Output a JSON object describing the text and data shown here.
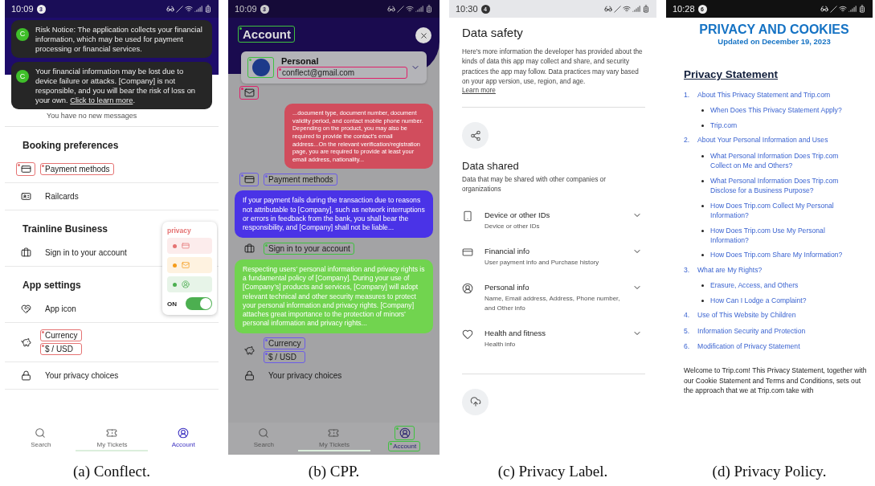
{
  "conflect": {
    "caption": "(a) Conflect.",
    "status": {
      "time": "10:09",
      "badge": "3"
    },
    "toasts": [
      {
        "avatar": "C",
        "text": "Risk Notice: The application collects your financial information, which may be used for payment processing or financial services."
      },
      {
        "avatar": "C",
        "text": "Your financial information may be lost due to device failure or attacks. [Company] is not responsible, and you will bear the risk of loss on your own. ",
        "link": "Click to learn more",
        "suffix": "."
      }
    ],
    "messages_note": "You have no new messages",
    "sections": [
      {
        "title": "Booking preferences",
        "rows": [
          {
            "kind": "card",
            "label": "Payment methods",
            "icon_highlight": {
              "color": "#e57373"
            },
            "label_highlight": {
              "color": "#e57373"
            }
          },
          {
            "kind": "railcard",
            "label": "Railcards"
          }
        ]
      },
      {
        "title": "Trainline Business",
        "rows": [
          {
            "kind": "briefcase",
            "label": "Sign in to your account"
          }
        ]
      },
      {
        "title": "App settings",
        "rows": [
          {
            "kind": "app",
            "label": "App icon"
          },
          {
            "kind": "piggy",
            "label": "Currency",
            "sub": "$ / USD",
            "label_highlight": {
              "color": "#e57373"
            },
            "sub_highlight": {
              "color": "#e57373"
            }
          },
          {
            "kind": "lock",
            "label": "Your privacy choices"
          }
        ]
      }
    ],
    "privacy_widget": {
      "title": "privacy",
      "items": [
        {
          "kind": "card",
          "color": "#e57373"
        },
        {
          "kind": "mail",
          "color": "#f59c1a"
        },
        {
          "kind": "user",
          "color": "#4caf50"
        }
      ],
      "toggle_label": "ON",
      "on": true
    },
    "nav": [
      {
        "kind": "search",
        "label": "Search",
        "selected": false
      },
      {
        "kind": "ticket",
        "label": "My Tickets",
        "selected": false
      },
      {
        "kind": "account",
        "label": "Account",
        "selected": true
      }
    ]
  },
  "cpp": {
    "caption": "(b) CPP.",
    "status": {
      "time": "10:09",
      "badge": "3"
    },
    "title": "Account",
    "title_highlight": {
      "color": "#3fc13f"
    },
    "profile": {
      "name": "Personal",
      "email": "conflect@gmail.com",
      "avatar_highlight": {
        "color": "#3fc13f"
      },
      "email_highlight": {
        "color": "#e0206a"
      }
    },
    "rows": [
      {
        "kind": "mail",
        "icon_highlight": {
          "color": "#e0206a"
        },
        "bubble": {
          "text": "...document type, document number, document validity period, and contact mobile phone number. Depending on the product, you may also be required to provide the contact’s email address...On the relevant verification/registration page, you are required to provide at least your email address, nationality...",
          "color": "#c8505e"
        }
      },
      {
        "kind": "card",
        "label": "Payment methods",
        "icon_highlight": {
          "color": "#6b5ce7"
        },
        "label_highlight": {
          "color": "#6b5ce7"
        },
        "bubble": {
          "text": "If your payment fails during the transaction due to reasons not attributable to [Company], such as network interruptions or errors in feedback from the bank, you shall bear the responsibility, and [Company] shall not be liable...",
          "color": "#4a35d8"
        }
      },
      {
        "kind": "briefcase",
        "label": "Sign in to your account",
        "label_highlight": {
          "color": "#3fc13f"
        },
        "bubble": {
          "text": "Respecting users’ personal information and privacy rights is a fundamental policy of [Company]. During your use of [Company’s] products and services, [Company] will adopt relevant technical and other security measures to protect your personal information and privacy rights. [Company] attaches great importance to the protection of minors’ personal information and privacy rights...",
          "color": "#77d158"
        }
      },
      {
        "kind": "piggy",
        "label": "Currency",
        "sub": "$ / USD",
        "label_highlight": {
          "color": "#6b5ce7"
        },
        "sub_highlight": {
          "color": "#6b5ce7"
        }
      },
      {
        "kind": "lock",
        "label": "Your privacy choices"
      }
    ],
    "nav": [
      {
        "kind": "search",
        "label": "Search",
        "selected": false
      },
      {
        "kind": "ticket",
        "label": "My Tickets",
        "selected": false
      },
      {
        "kind": "account",
        "label": "Account",
        "selected": true,
        "icon_highlight": {
          "color": "#3fc13f"
        },
        "label_highlight": {
          "color": "#3fc13f"
        }
      }
    ]
  },
  "privacy_label": {
    "caption": "(c) Privacy Label.",
    "status": {
      "time": "10:30",
      "badge": "4"
    },
    "title": "Data safety",
    "intro": "Here's more information the developer has provided about the kinds of data this app may collect and share, and security practices the app may follow. Data practices may vary based on your app version, use, region, and age.",
    "link": "Learn more",
    "section_title": "Data shared",
    "section_sub": "Data that may be shared with other companies or organizations",
    "items": [
      {
        "kind": "device",
        "title": "Device or other IDs",
        "detail": "Device or other IDs"
      },
      {
        "kind": "card",
        "title": "Financial info",
        "detail": "User payment info and Purchase history"
      },
      {
        "kind": "user",
        "title": "Personal info",
        "detail": "Name, Email address, Address, Phone number, and Other info"
      },
      {
        "kind": "heart",
        "title": "Health and fitness",
        "detail": "Health info"
      }
    ]
  },
  "privacy_policy": {
    "caption": "(d) Privacy Policy.",
    "status": {
      "time": "10:28",
      "badge": "6"
    },
    "title": "PRIVACY AND COOKIES",
    "updated": "Updated on December 19, 2023",
    "heading": "Privacy Statement",
    "toc": [
      {
        "number": "1.",
        "text": "About This Privacy Statement and Trip.com",
        "children": [
          {
            "text": "When Does This Privacy Statement Apply?"
          },
          {
            "text": "Trip.com"
          }
        ]
      },
      {
        "number": "2.",
        "text": "About Your Personal Information and Uses",
        "children": [
          {
            "text": "What Personal Information Does Trip.com Collect on Me and Others?"
          },
          {
            "text": "What Personal Information Does Trip.com Disclose for a Business Purpose?"
          },
          {
            "text": "How Does Trip.com Collect My Personal Information?"
          },
          {
            "text": "How Does Trip.com Use My Personal Information?"
          },
          {
            "text": "How Does Trip.com Share My Information?"
          }
        ]
      },
      {
        "number": "3.",
        "text": "What are My Rights?",
        "children": [
          {
            "text": "Erasure, Access, and Others"
          },
          {
            "text": "How Can I Lodge a Complaint?"
          }
        ]
      },
      {
        "number": "4.",
        "text": "Use of This Website by Children"
      },
      {
        "number": "5.",
        "text": "Information Security and Protection"
      },
      {
        "number": "6.",
        "text": "Modification of Privacy Statement"
      }
    ],
    "body": "Welcome to Trip.com! This Privacy Statement, together with our Cookie Statement and Terms and Conditions, sets out the approach that we at Trip.com take with"
  }
}
